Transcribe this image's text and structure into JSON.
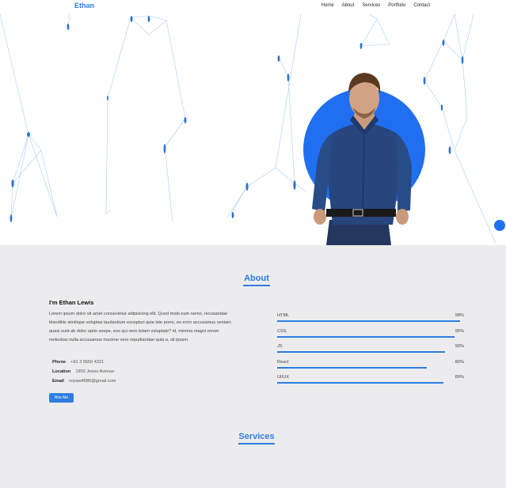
{
  "nav": {
    "brand": "Ethan",
    "items": [
      "Home",
      "About",
      "Services",
      "Portfolio",
      "Contact"
    ]
  },
  "about": {
    "title": "About",
    "heading": "I'm Ethan Lewis",
    "paragraph": "Lorem ipsum dolor sit amet consectetur adipisicing elit. Quod modi eum nemo, recusandae blanditiis similique voluptas laudantium excepturi quia iste porro, eo error accusamus veniam quasi sunt ab dolor optio soepe, eos qui vero totam voluptate? id, minima magni rerum molestias nulla accusamus maxime vero repudiandae quia a, sit ipsam.",
    "phone_label": "Phone",
    "phone": "+91 3 5550 4321",
    "location_label": "Location",
    "location": "1902 Jones Avenue",
    "email_label": "Email",
    "email": "voyaw4580@gmail.com",
    "hire_label": "Hire Me"
  },
  "skills": [
    {
      "name": "HTML",
      "percent_label": "98%",
      "level": 98
    },
    {
      "name": "CSS",
      "percent_label": "95%",
      "level": 95
    },
    {
      "name": "JS",
      "percent_label": "90%",
      "level": 90
    },
    {
      "name": "React",
      "percent_label": "80%",
      "level": 80
    },
    {
      "name": "UI/UX",
      "percent_label": "89%",
      "level": 89
    }
  ],
  "services": {
    "title": "Services"
  },
  "colors": {
    "accent": "#2f7de1",
    "circle": "#1f6ff0",
    "section_bg": "#ececee"
  }
}
